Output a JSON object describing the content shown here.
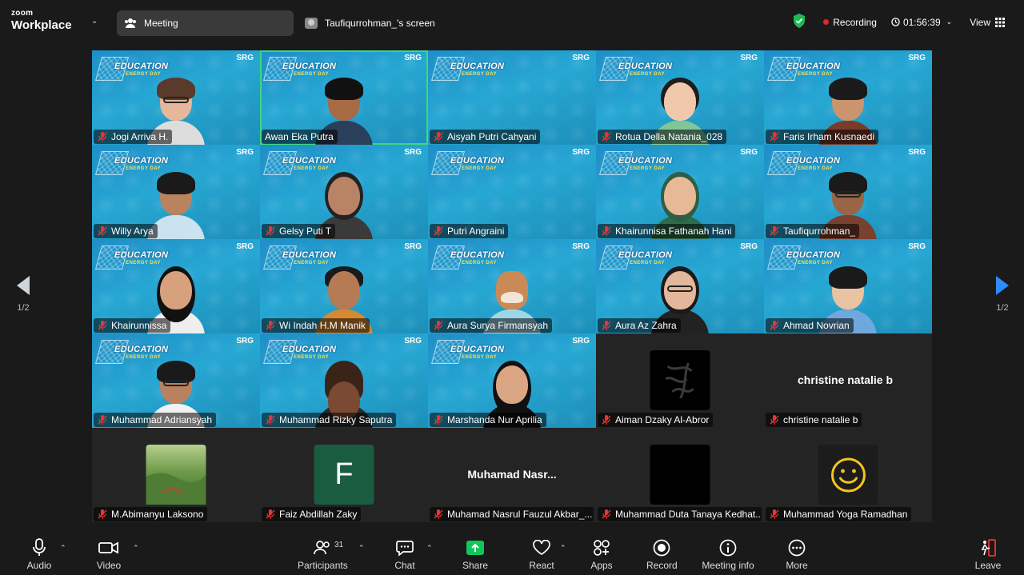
{
  "app": {
    "brand_small": "zoom",
    "brand_large": "Workplace"
  },
  "tabs": {
    "meeting": "Meeting",
    "screen": "Taufiqurrohman_'s screen"
  },
  "status": {
    "recording": "Recording",
    "timer": "01:56:39",
    "view": "View"
  },
  "pager": {
    "left": "1/2",
    "right": "1/2"
  },
  "banner": {
    "title": "EDUCATION",
    "subtitle": "ENERGY DAY",
    "logo": "SRG"
  },
  "participants": [
    {
      "name": "Jogi Arriva H."
    },
    {
      "name": "Awan Eka Putra"
    },
    {
      "name": "Aisyah Putri Cahyani"
    },
    {
      "name": "Rotua Della Natania_028"
    },
    {
      "name": "Faris Irham Kusnaedi"
    },
    {
      "name": "Willy Arya"
    },
    {
      "name": "Gelsy Puti T"
    },
    {
      "name": "Putri Angraini"
    },
    {
      "name": "Khairunnisa Fathanah Hani"
    },
    {
      "name": "Taufiqurrohman_"
    },
    {
      "name": "Khairunnissa"
    },
    {
      "name": "Wi Indah H.M Manik"
    },
    {
      "name": "Aura Surya Firmansyah"
    },
    {
      "name": "Aura Az Zahra"
    },
    {
      "name": "Ahmad Novrian"
    },
    {
      "name": "Muhammad Adriansyah"
    },
    {
      "name": "Muhammad Rizky Saputra"
    },
    {
      "name": "Marshanda Nur Aprilia"
    },
    {
      "name": "Aiman Dzaky Al-Abror"
    },
    {
      "name": "christine natalie b",
      "display": "christine natalie b"
    },
    {
      "name": "M.Abimanyu Laksono"
    },
    {
      "name": "Faiz Abdillah Zaky",
      "initial": "F"
    },
    {
      "name": "Muhamad Nasrul Fauzul Akbar_...",
      "display": "Muhamad  Nasr..."
    },
    {
      "name": "Muhammad Duta Tanaya Kedhat..."
    },
    {
      "name": "Muhammad Yoga Ramadhan"
    }
  ],
  "toolbar": {
    "audio": "Audio",
    "video": "Video",
    "participants": "Participants",
    "participants_count": "31",
    "chat": "Chat",
    "share": "Share",
    "react": "React",
    "apps": "Apps",
    "record": "Record",
    "meeting_info": "Meeting info",
    "more": "More",
    "leave": "Leave"
  },
  "colors": {
    "active_speaker": "#3fd87a",
    "share_green": "#12c75a",
    "recording_red": "#e02828",
    "nav_blue": "#2d8cff"
  }
}
